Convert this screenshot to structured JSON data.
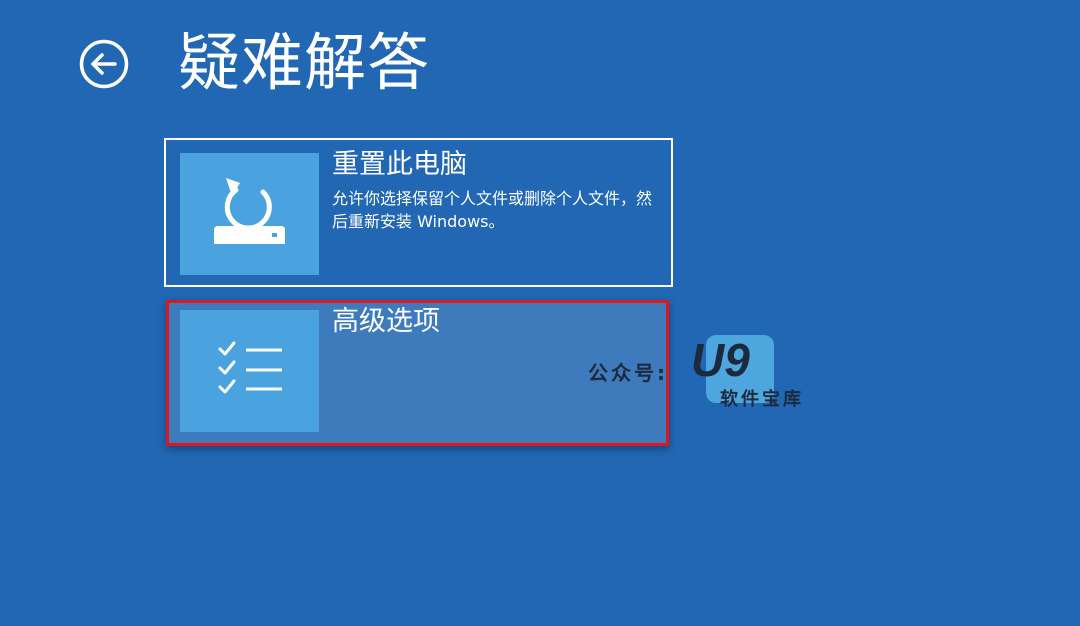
{
  "header": {
    "back_icon": "back-arrow-circle-icon",
    "title": "疑难解答"
  },
  "options": [
    {
      "id": "reset",
      "icon": "reset-pc-icon",
      "title": "重置此电脑",
      "description": "允许你选择保留个人文件或删除个人文件，然后重新安装 Windows。"
    },
    {
      "id": "advanced",
      "icon": "checklist-icon",
      "title": "高级选项",
      "highlight_color": "#e0161f"
    }
  ],
  "watermark": {
    "prefix": "公众号:",
    "logo": "U9",
    "subtitle": "软件宝库"
  },
  "colors": {
    "background": "#2167b4",
    "icon_box": "#4aa3df",
    "selected_tile": "#3e7bbd"
  }
}
